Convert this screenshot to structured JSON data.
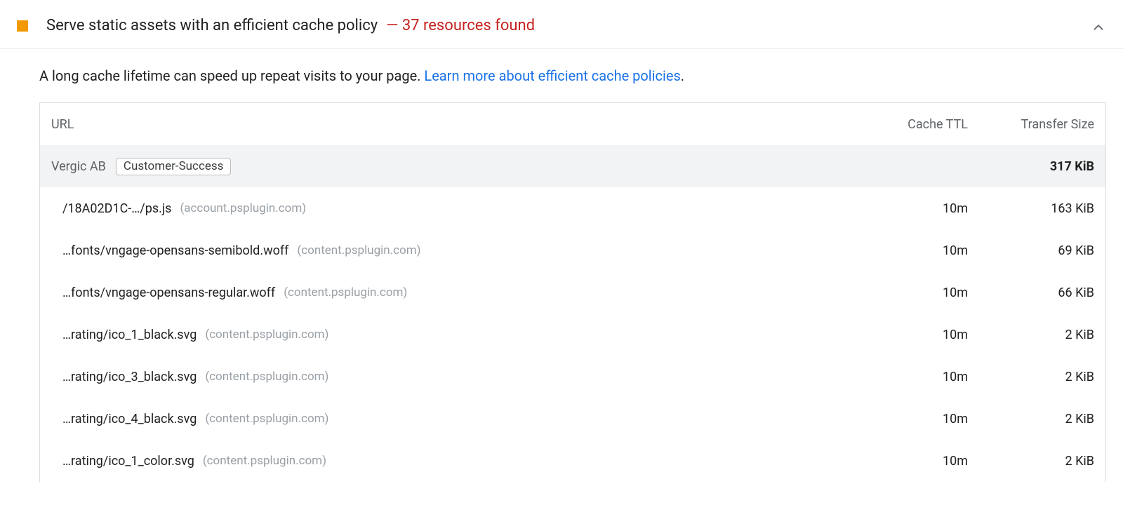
{
  "audit": {
    "title": "Serve static assets with an efficient cache policy",
    "subtitle": "—  37 resources found",
    "description_text": "A long cache lifetime can speed up repeat visits to your page. ",
    "description_link": "Learn more about efficient cache policies",
    "description_suffix": "."
  },
  "table": {
    "headers": {
      "url": "URL",
      "ttl": "Cache TTL",
      "size": "Transfer Size"
    },
    "group": {
      "name": "Vergic AB",
      "chip": "Customer-Success",
      "total": "317 KiB"
    },
    "rows": [
      {
        "path": "/18A02D1C-…/ps.js",
        "origin": "(account.psplugin.com)",
        "ttl": "10m",
        "size": "163 KiB"
      },
      {
        "path": "…fonts/vngage-opensans-semibold.woff",
        "origin": "(content.psplugin.com)",
        "ttl": "10m",
        "size": "69 KiB"
      },
      {
        "path": "…fonts/vngage-opensans-regular.woff",
        "origin": "(content.psplugin.com)",
        "ttl": "10m",
        "size": "66 KiB"
      },
      {
        "path": "…rating/ico_1_black.svg",
        "origin": "(content.psplugin.com)",
        "ttl": "10m",
        "size": "2 KiB"
      },
      {
        "path": "…rating/ico_3_black.svg",
        "origin": "(content.psplugin.com)",
        "ttl": "10m",
        "size": "2 KiB"
      },
      {
        "path": "…rating/ico_4_black.svg",
        "origin": "(content.psplugin.com)",
        "ttl": "10m",
        "size": "2 KiB"
      },
      {
        "path": "…rating/ico_1_color.svg",
        "origin": "(content.psplugin.com)",
        "ttl": "10m",
        "size": "2 KiB"
      }
    ]
  }
}
